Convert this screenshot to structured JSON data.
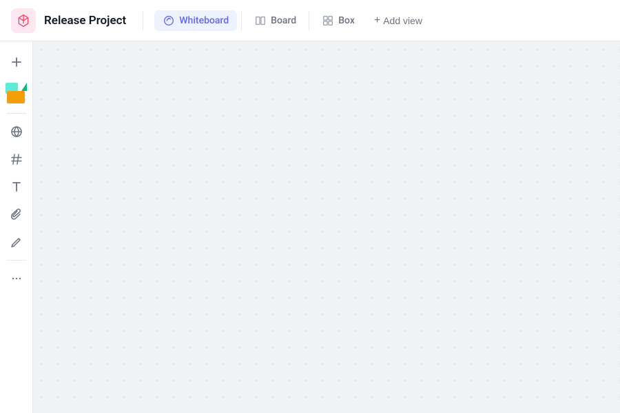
{
  "header": {
    "project_title": "Release Project",
    "tabs": [
      {
        "id": "whiteboard",
        "label": "Whiteboard",
        "active": true
      },
      {
        "id": "board",
        "label": "Board",
        "active": false
      },
      {
        "id": "box",
        "label": "Box",
        "active": false
      }
    ],
    "add_view_label": "Add view"
  },
  "toolbar": {
    "buttons": [
      {
        "id": "add",
        "icon": "plus-icon",
        "symbol": "+"
      },
      {
        "id": "sticky",
        "icon": "sticky-note-icon",
        "symbol": ""
      },
      {
        "id": "globe",
        "icon": "globe-icon",
        "symbol": "⊕"
      },
      {
        "id": "hash",
        "icon": "hash-icon",
        "symbol": "#"
      },
      {
        "id": "text",
        "icon": "text-icon",
        "symbol": "T"
      },
      {
        "id": "attach",
        "icon": "attach-icon",
        "symbol": "∂"
      },
      {
        "id": "draw",
        "icon": "draw-icon",
        "symbol": "✎"
      },
      {
        "id": "more",
        "icon": "more-icon",
        "symbol": "···"
      }
    ]
  },
  "canvas": {
    "background": "#f0f2f5"
  },
  "colors": {
    "active_tab": "#6366f1",
    "active_tab_bg": "#eef2ff",
    "header_bg": "#ffffff",
    "canvas_bg": "#f0f2f5"
  }
}
